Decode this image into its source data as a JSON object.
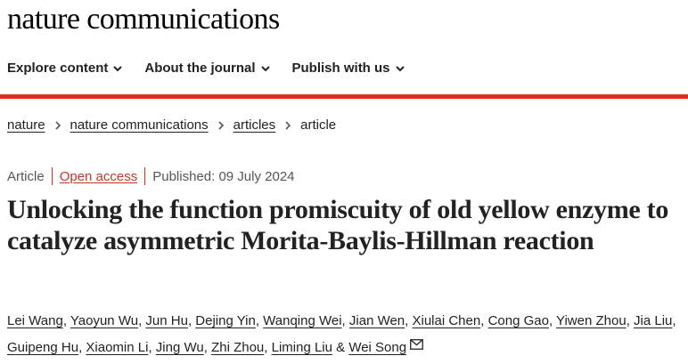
{
  "site": {
    "logo": "nature communications"
  },
  "nav": {
    "items": [
      {
        "label": "Explore content",
        "icon": "chevron-down-icon"
      },
      {
        "label": "About the journal",
        "icon": "chevron-down-icon"
      },
      {
        "label": "Publish with us",
        "icon": "chevron-down-icon"
      }
    ]
  },
  "breadcrumb": {
    "items": [
      "nature",
      "nature communications",
      "articles"
    ],
    "current": "article"
  },
  "article": {
    "type": "Article",
    "access": "Open access",
    "published": "Published: 09 July 2024",
    "title": "Unlocking the function promiscuity of old yellow enzyme to catalyze asymmetric Morita-Baylis-Hillman reaction",
    "authors": [
      "Lei Wang",
      "Yaoyun Wu",
      "Jun Hu",
      "Dejing Yin",
      "Wanqing Wei",
      "Jian Wen",
      "Xiulai Chen",
      "Cong Gao",
      "Yiwen Zhou",
      "Jia Liu",
      "Guipeng Hu",
      "Xiaomin Li",
      "Jing Wu",
      "Zhi Zhou",
      "Liming Liu",
      "Wei Song"
    ],
    "ampersand": "&",
    "corresponding_icon": "mail-icon"
  },
  "colors": {
    "accent": "#e0301e",
    "text": "#222222",
    "open_access": "#c0392b"
  }
}
